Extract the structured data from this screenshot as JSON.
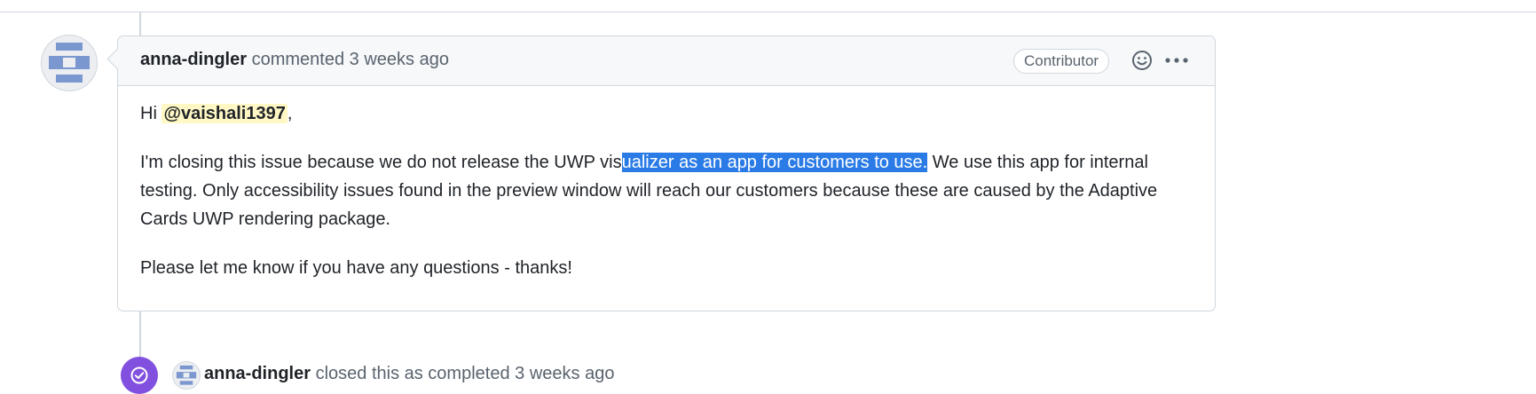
{
  "comment": {
    "author": "anna-dingler",
    "action": "commented",
    "time": "3 weeks ago",
    "badge": "Contributor",
    "greeting_prefix": "Hi",
    "mention": "@vaishali1397",
    "greeting_suffix": ",",
    "para1_before": "I'm closing this issue because we do not release the UWP vis",
    "para1_selected": "ualizer as an app for customers to use.",
    "para1_after": " We use this app for internal testing. Only accessibility issues found in the preview window will reach our customers because these are caused by the Adaptive Cards UWP rendering package.",
    "para2": "Please let me know if you have any questions - thanks!"
  },
  "event": {
    "author": "anna-dingler",
    "text": "closed this as completed",
    "time": "3 weeks ago"
  },
  "colors": {
    "selection": "#2b7be6",
    "mention_bg": "#fff8c5",
    "closed_badge": "#8250df"
  },
  "icons": {
    "avatar": "identicon",
    "reaction": "smiley-icon",
    "menu": "kebab-horizontal-icon",
    "closed": "check-circle-icon"
  }
}
